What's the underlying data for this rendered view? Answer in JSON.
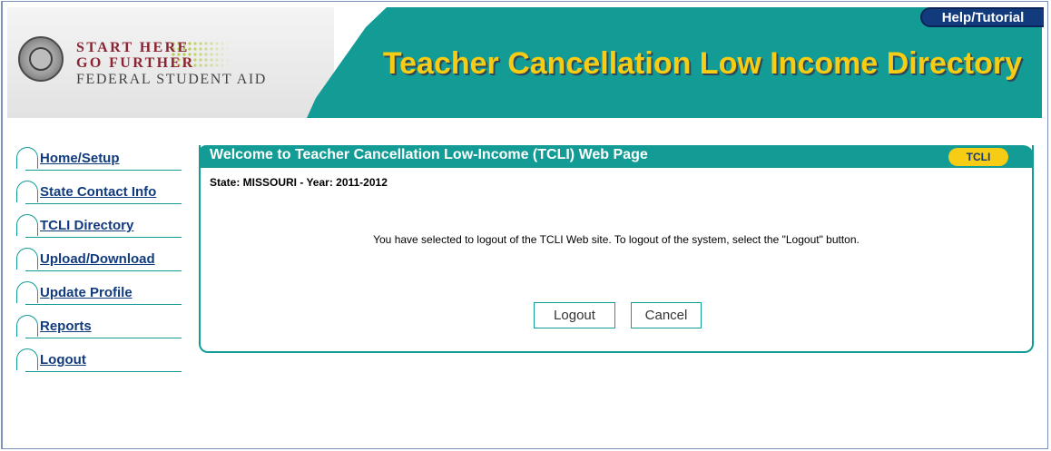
{
  "header": {
    "logo": {
      "line1": "START HERE",
      "line2": "GO FURTHER",
      "line3": "FEDERAL STUDENT AID"
    },
    "title": "Teacher Cancellation Low Income Directory",
    "help_label": "Help/Tutorial"
  },
  "sidebar": {
    "items": [
      {
        "label": "Home/Setup"
      },
      {
        "label": "State Contact Info"
      },
      {
        "label": "TCLI Directory"
      },
      {
        "label": "Upload/Download"
      },
      {
        "label": "Update Profile"
      },
      {
        "label": "Reports"
      },
      {
        "label": "Logout"
      }
    ]
  },
  "panel": {
    "title": "Welcome to Teacher Cancellation Low-Income (TCLI) Web Page",
    "badge": "TCLI",
    "state_line": "State: MISSOURI - Year: 2011-2012",
    "message": "You have selected to logout of the TCLI Web site. To logout of the system, select the \"Logout\" button.",
    "logout_label": "Logout",
    "cancel_label": "Cancel"
  },
  "colors": {
    "teal": "#139c96",
    "title_yellow": "#f7cc14",
    "navy": "#123b7e",
    "logo_red": "#8a2432"
  },
  "icons": {
    "seal": "federal-seal-icon",
    "nav_marker": "nav-arc-icon"
  }
}
